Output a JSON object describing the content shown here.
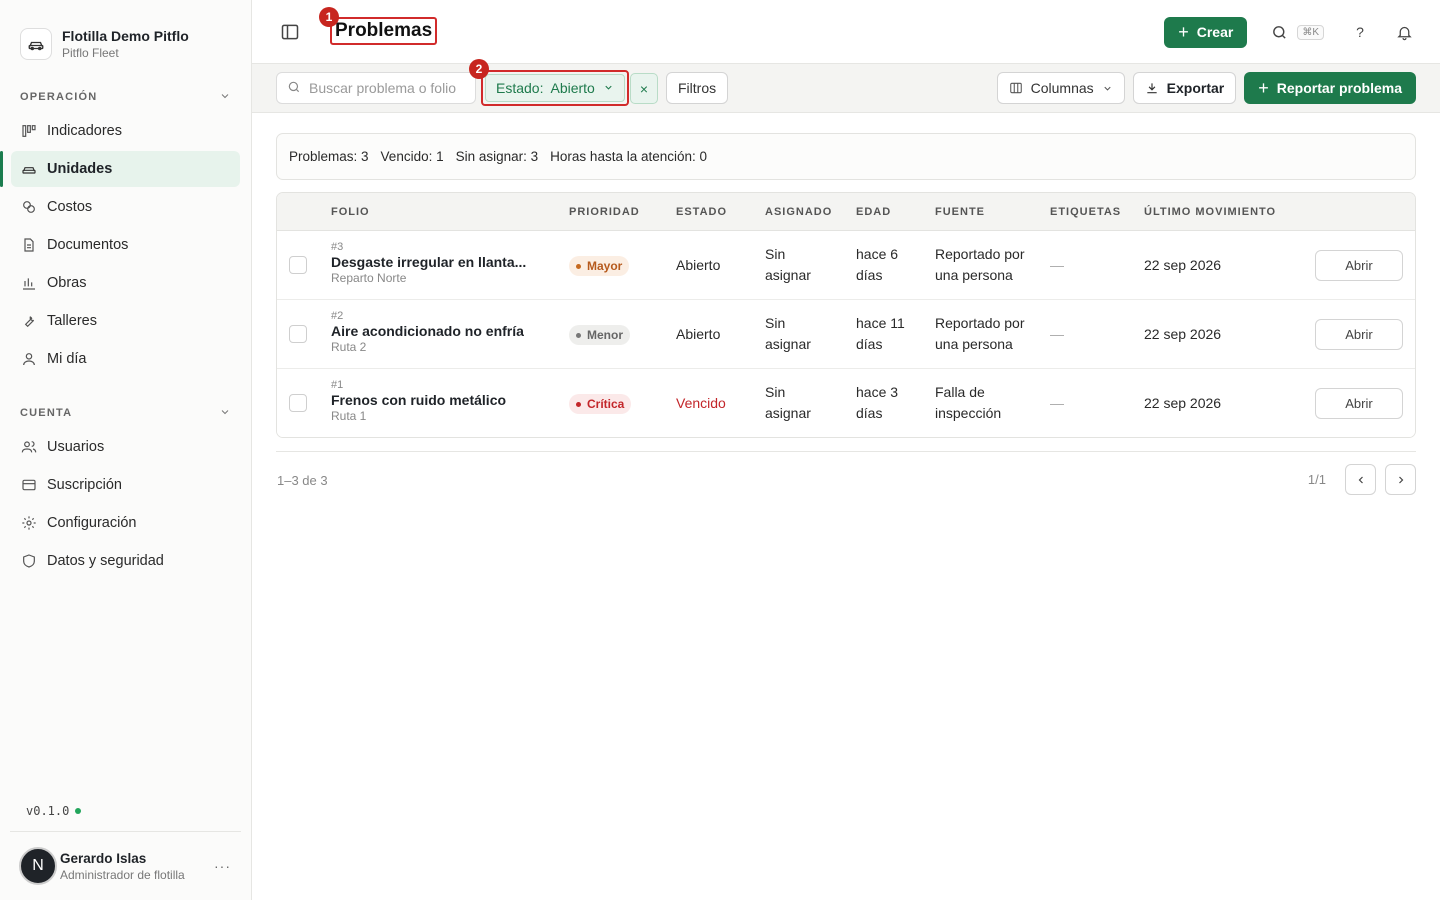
{
  "org": {
    "name": "Flotilla Demo Pitflo",
    "subtitle": "Pitflo Fleet"
  },
  "sidebar": {
    "sections": [
      {
        "title": "OPERACIÓN"
      },
      {
        "title": "CUENTA"
      }
    ],
    "operacion": [
      {
        "label": "Indicadores",
        "icon": "kanban-icon"
      },
      {
        "label": "Unidades",
        "icon": "car-icon",
        "active": true
      },
      {
        "label": "Costos",
        "icon": "coins-icon"
      },
      {
        "label": "Documentos",
        "icon": "document-icon"
      },
      {
        "label": "Obras",
        "icon": "bar-chart-icon"
      },
      {
        "label": "Talleres",
        "icon": "wrench-icon"
      },
      {
        "label": "Mi día",
        "icon": "user-icon"
      }
    ],
    "cuenta": [
      {
        "label": "Usuarios",
        "icon": "users-icon"
      },
      {
        "label": "Suscripción",
        "icon": "card-icon"
      },
      {
        "label": "Configuración",
        "icon": "gear-icon"
      },
      {
        "label": "Datos y seguridad",
        "icon": "shield-icon"
      }
    ],
    "version": "v0.1.0",
    "status_color": "#22a55b"
  },
  "user": {
    "initial": "N",
    "name": "Gerardo Islas",
    "role": "Administrador de flotilla",
    "more": "···"
  },
  "header": {
    "title": "Problemas",
    "marker1": "1",
    "create_label": "Crear",
    "shortcut": "⌘K",
    "help": "?"
  },
  "toolbar": {
    "search_placeholder": "Buscar problema o folio",
    "filter_label": "Estado:  Abierto",
    "marker2": "2",
    "clear": "×",
    "filters_label": "Filtros",
    "columns_label": "Columnas",
    "export_label": "Exportar",
    "report_label": "Reportar problema"
  },
  "summary": {
    "problemas": "Problemas: 3",
    "vencido": "Vencido: 1",
    "sin_asignar": "Sin asignar: 3",
    "horas": "Horas hasta la atención: 0"
  },
  "table": {
    "headers": [
      "FOLIO",
      "PRIORIDAD",
      "ESTADO",
      "ASIGNADO",
      "EDAD",
      "FUENTE",
      "ETIQUETAS",
      "ÚLTIMO MOVIMIENTO"
    ],
    "rows": [
      {
        "num": "#3",
        "title": "Desgaste irregular en llanta...",
        "sub": "Reparto Norte",
        "priority": "Mayor",
        "status": "Abierto",
        "assigned1": "Sin",
        "assigned2": "asignar",
        "age1": "hace 6",
        "age2": "días",
        "source1": "Reportado por",
        "source2": "una persona",
        "tags": "—",
        "last": "22 sep 2026",
        "action": "Abrir"
      },
      {
        "num": "#2",
        "title": "Aire acondicionado no enfría",
        "sub": "Ruta 2",
        "priority": "Menor",
        "status": "Abierto",
        "assigned1": "Sin",
        "assigned2": "asignar",
        "age1": "hace 11",
        "age2": "días",
        "source1": "Reportado por",
        "source2": "una persona",
        "tags": "—",
        "last": "22 sep 2026",
        "action": "Abrir"
      },
      {
        "num": "#1",
        "title": "Frenos con ruido metálico",
        "sub": "Ruta 1",
        "priority": "Crítica",
        "status": "Vencido",
        "assigned1": "Sin",
        "assigned2": "asignar",
        "age1": "hace 3",
        "age2": "días",
        "source1": "Falla de",
        "source2": "inspección",
        "tags": "—",
        "last": "22 sep 2026",
        "action": "Abrir"
      }
    ]
  },
  "pagination": {
    "range": "1–3 de 3",
    "page": "1/1"
  },
  "colors": {
    "accent": "#1e7a4c",
    "danger": "#c3262a",
    "highlight": "#d12b2b"
  }
}
